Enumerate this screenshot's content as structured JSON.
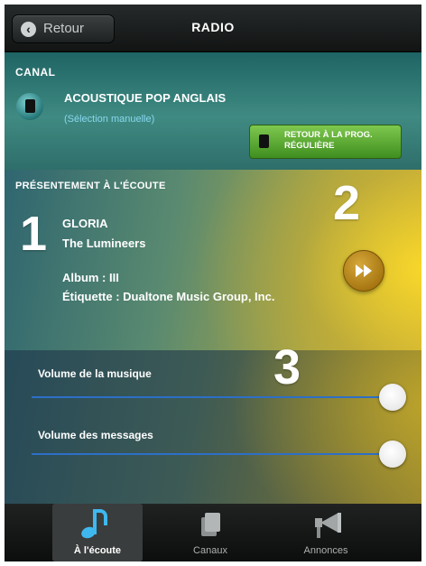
{
  "header": {
    "back_label": "Retour",
    "title": "RADIO"
  },
  "canal": {
    "heading": "CANAL",
    "name": "ACOUSTIQUE POP ANGLAIS",
    "mode": "(Sélection manuelle)",
    "return_button_label": "RETOUR À LA PROG. RÉGULIÈRE"
  },
  "now_playing": {
    "heading": "PRÉSENTEMENT À L'ÉCOUTE",
    "song": "GLORIA",
    "artist": "The Lumineers",
    "album": "Album : III",
    "label": "Étiquette : Dualtone Music Group, Inc."
  },
  "callouts": {
    "one": "1",
    "two": "2",
    "three": "3"
  },
  "volume": {
    "music_label": "Volume de la musique",
    "music_level": 1.0,
    "messages_label": "Volume des messages",
    "messages_level": 1.0
  },
  "tabs": [
    {
      "label": "À l'écoute",
      "icon": "music-note-icon",
      "active": true
    },
    {
      "label": "Canaux",
      "icon": "channels-icon",
      "active": false
    },
    {
      "label": "Annonces",
      "icon": "megaphone-icon",
      "active": false
    }
  ],
  "colors": {
    "accent_blue": "#3fb8ef",
    "green_button": "#5aa832",
    "slider_track": "#2d6fc8"
  }
}
